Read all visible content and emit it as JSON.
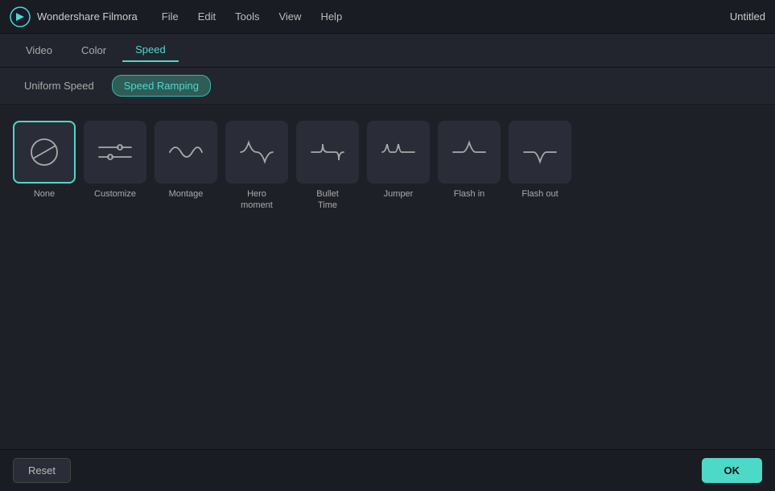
{
  "titlebar": {
    "app_name": "Wondershare Filmora",
    "menu_items": [
      "File",
      "Edit",
      "Tools",
      "View",
      "Help"
    ],
    "title": "Untitled"
  },
  "tabs": {
    "items": [
      {
        "label": "Video",
        "active": false
      },
      {
        "label": "Color",
        "active": false
      },
      {
        "label": "Speed",
        "active": true
      }
    ]
  },
  "subtabs": {
    "items": [
      {
        "label": "Uniform Speed",
        "active": false
      },
      {
        "label": "Speed Ramping",
        "active": true
      }
    ]
  },
  "speed_items": [
    {
      "id": "none",
      "label": "None",
      "selected": true,
      "icon": "none"
    },
    {
      "id": "customize",
      "label": "Customize",
      "selected": false,
      "icon": "customize"
    },
    {
      "id": "montage",
      "label": "Montage",
      "selected": false,
      "icon": "montage"
    },
    {
      "id": "hero-moment",
      "label": "Hero\nmoment",
      "selected": false,
      "icon": "hero"
    },
    {
      "id": "bullet-time",
      "label": "Bullet\nTime",
      "selected": false,
      "icon": "bullet"
    },
    {
      "id": "jumper",
      "label": "Jumper",
      "selected": false,
      "icon": "jumper"
    },
    {
      "id": "flash-in",
      "label": "Flash in",
      "selected": false,
      "icon": "flash-in"
    },
    {
      "id": "flash-out",
      "label": "Flash out",
      "selected": false,
      "icon": "flash-out"
    }
  ],
  "buttons": {
    "reset": "Reset",
    "ok": "OK"
  }
}
